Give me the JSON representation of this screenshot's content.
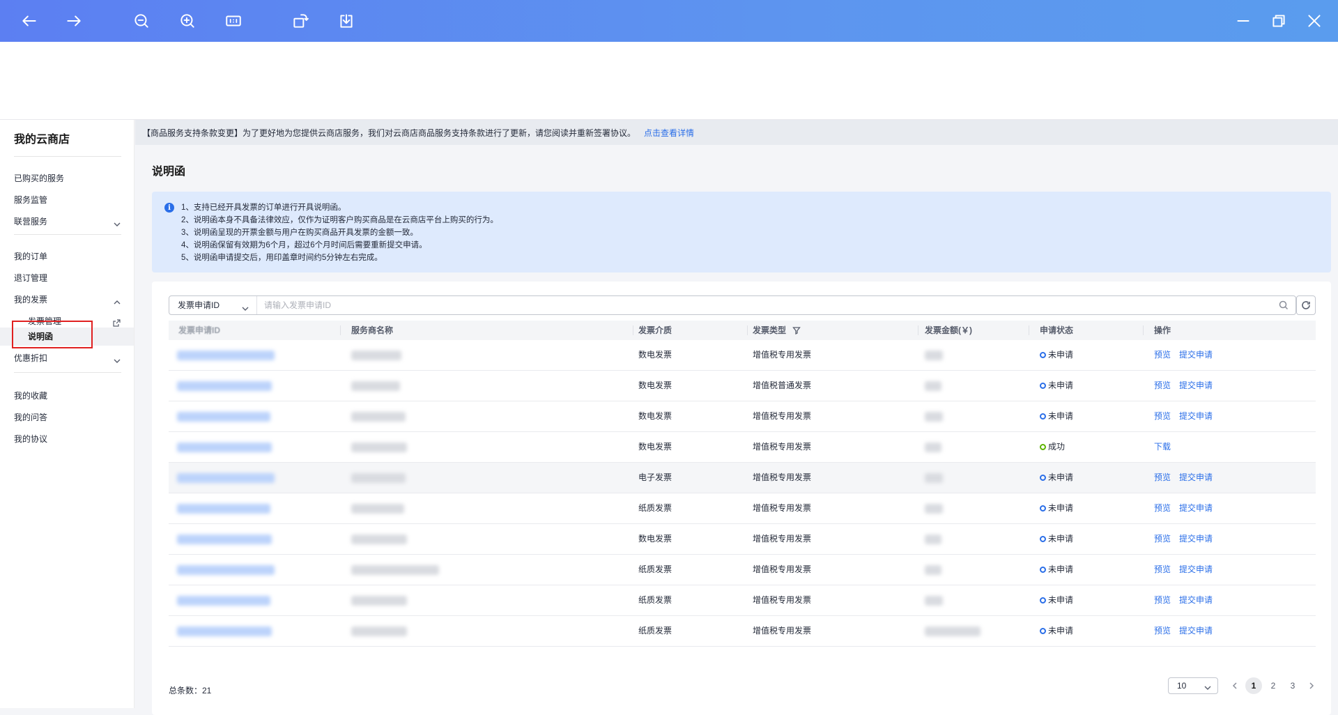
{
  "viewer": {
    "buttons": [
      "back",
      "forward",
      "zoom-out",
      "zoom-in",
      "actual-size",
      "rotate",
      "download"
    ],
    "actual_size_label": "1:1",
    "window_controls": [
      "minimize",
      "restore",
      "close"
    ],
    "bar_color": "#5d8ff0"
  },
  "sidebar": {
    "title": "我的云商店",
    "group1": [
      "已购买的服务",
      "服务监管",
      "联营服务"
    ],
    "group2": {
      "orders": "我的订单",
      "refund": "退订管理",
      "invoice": "我的发票",
      "invoice_mgmt": "发票管理",
      "explain_letter": "说明函",
      "discount": "优惠折扣"
    },
    "group3": [
      "我的收藏",
      "我的问答",
      "我的协议"
    ]
  },
  "notice": {
    "text": "【商品服务支持条款变更】为了更好地为您提供云商店服务，我们对云商店商品服务支持条款进行了更新，请您阅读并重新签署协议。",
    "link": "点击查看详情"
  },
  "main": {
    "title": "说明函",
    "info_lines": [
      "1、支持已经开具发票的订单进行开具说明函。",
      "2、说明函本身不具备法律效应，仅作为证明客户购买商品是在云商店平台上购买的行为。",
      "3、说明函呈现的开票金额与用户在购买商品开具发票的金额一致。",
      "4、说明函保留有效期为6个月，超过6个月时间后需要重新提交申请。",
      "5、说明函申请提交后，用印盖章时间约5分钟左右完成。"
    ]
  },
  "search": {
    "select_value": "发票申请ID",
    "placeholder": "请输入发票申请ID"
  },
  "table": {
    "headers": {
      "id": "发票申请ID",
      "service": "服务商名称",
      "medium": "发票介质",
      "type": "发票类型",
      "amount": "发票金额(￥)",
      "status": "申请状态",
      "ops": "操作"
    },
    "rows": [
      {
        "medium": "数电发票",
        "type": "增值税专用发票",
        "status": "未申请",
        "ok": false,
        "ops": [
          "预览",
          "提交申请"
        ]
      },
      {
        "medium": "数电发票",
        "type": "增值税普通发票",
        "status": "未申请",
        "ok": false,
        "ops": [
          "预览",
          "提交申请"
        ]
      },
      {
        "medium": "数电发票",
        "type": "增值税专用发票",
        "status": "未申请",
        "ok": false,
        "ops": [
          "预览",
          "提交申请"
        ]
      },
      {
        "medium": "数电发票",
        "type": "增值税专用发票",
        "status": "成功",
        "ok": true,
        "ops": [
          "下载"
        ]
      },
      {
        "medium": "电子发票",
        "type": "增值税专用发票",
        "status": "未申请",
        "ok": false,
        "ops": [
          "预览",
          "提交申请"
        ]
      },
      {
        "medium": "纸质发票",
        "type": "增值税专用发票",
        "status": "未申请",
        "ok": false,
        "ops": [
          "预览",
          "提交申请"
        ]
      },
      {
        "medium": "数电发票",
        "type": "增值税专用发票",
        "status": "未申请",
        "ok": false,
        "ops": [
          "预览",
          "提交申请"
        ]
      },
      {
        "medium": "纸质发票",
        "type": "增值税专用发票",
        "status": "未申请",
        "ok": false,
        "ops": [
          "预览",
          "提交申请"
        ]
      },
      {
        "medium": "纸质发票",
        "type": "增值税专用发票",
        "status": "未申请",
        "ok": false,
        "ops": [
          "预览",
          "提交申请"
        ]
      },
      {
        "medium": "纸质发票",
        "type": "增值税专用发票",
        "status": "未申请",
        "ok": false,
        "ops": [
          "预览",
          "提交申请"
        ]
      }
    ]
  },
  "footer": {
    "total": "总条数：21",
    "page_size": "10",
    "pages": [
      "1",
      "2",
      "3"
    ],
    "current_page": "1"
  },
  "colors": {
    "link": "#2a6ee8",
    "status_pending": "#2a6ee8",
    "status_success": "#5cb300",
    "highlight_box": "#e02020"
  }
}
